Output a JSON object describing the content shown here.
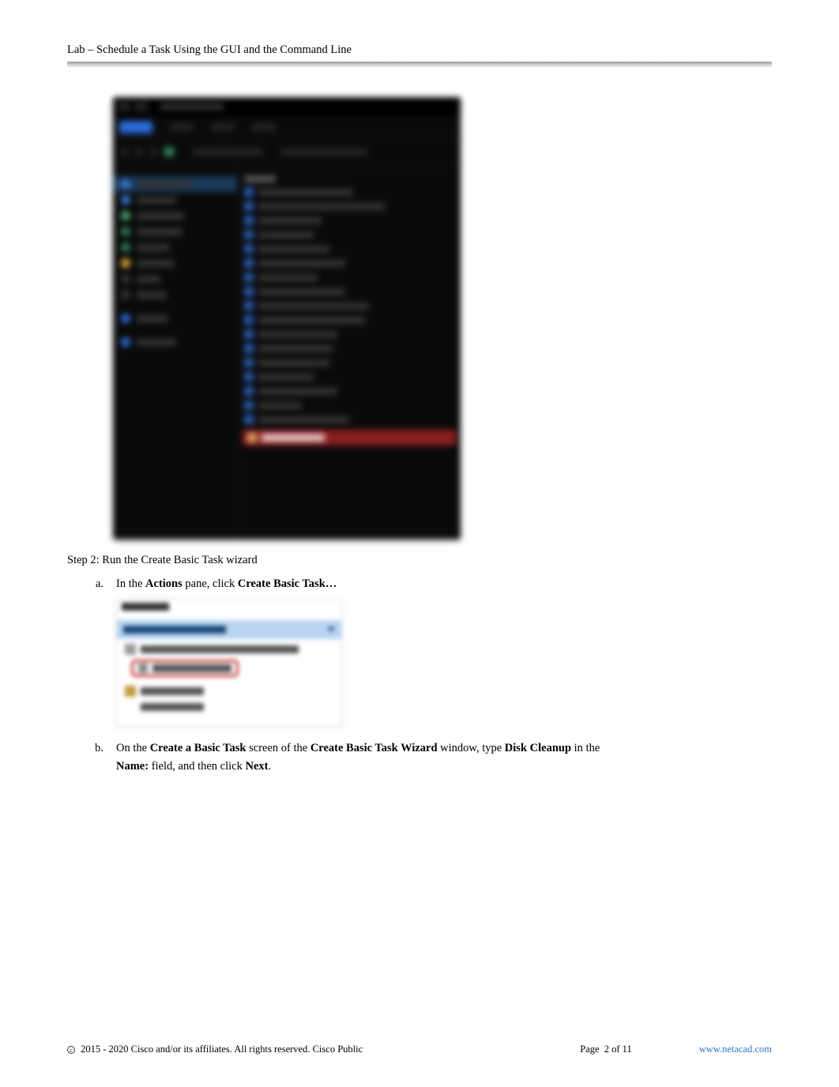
{
  "header": {
    "title": "Lab – Schedule a Task Using the GUI and the Command Line"
  },
  "step": {
    "heading": "Step 2: Run the Create Basic Task wizard",
    "items": [
      {
        "marker": "a.",
        "pre": "In the",
        "bold1": "Actions",
        "mid1": "pane, click",
        "bold2": "Create Basic Task…"
      },
      {
        "marker": "b.",
        "pre": "On the",
        "bold1": "Create a Basic Task",
        "mid1": "screen of the",
        "bold2": "Create Basic Task Wizard",
        "mid2": "window, type",
        "bold3": "Disk Cleanup",
        "mid3": "in the",
        "line2bold": "Name:",
        "line2mid": "field, and then click",
        "line2bold2": "Next",
        "line2end": "."
      }
    ]
  },
  "footer": {
    "copyright": "2015 - 2020 Cisco and/or its affiliates. All rights reserved. Cisco Public",
    "page_label": "Page",
    "page_current": "2",
    "page_of": "of",
    "page_total": "11",
    "link": "www.netacad.com"
  }
}
